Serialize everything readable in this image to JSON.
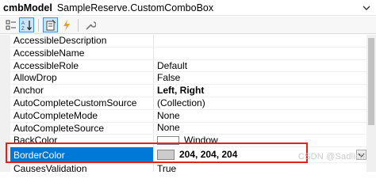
{
  "header": {
    "name": "cmbModel",
    "type": "SampleReserve.CustomComboBox"
  },
  "toolbar": {
    "buttons": [
      {
        "icon": "categorized-icon"
      },
      {
        "icon": "alphabetical-icon"
      },
      {
        "icon": "properties-icon"
      },
      {
        "icon": "events-lightning-icon"
      },
      {
        "icon": "property-pages-wrench-icon"
      }
    ]
  },
  "properties": [
    {
      "name": "AccessibleDescription",
      "value": ""
    },
    {
      "name": "AccessibleName",
      "value": ""
    },
    {
      "name": "AccessibleRole",
      "value": "Default"
    },
    {
      "name": "AllowDrop",
      "value": "False"
    },
    {
      "name": "Anchor",
      "value": "Left, Right"
    },
    {
      "name": "AutoCompleteCustomSource",
      "value": "(Collection)"
    },
    {
      "name": "AutoCompleteMode",
      "value": "None"
    },
    {
      "name": "AutoCompleteSource",
      "value": "None"
    },
    {
      "name": "BackColor",
      "value": "Window"
    },
    {
      "name": "BorderColor",
      "value": "204, 204, 204"
    },
    {
      "name": "CausesValidation",
      "value": "True"
    }
  ],
  "colors": {
    "backcolor_swatch": "#ffffff",
    "bordercolor_swatch": "#cccccc",
    "selection": "#0078d7",
    "highlight_box": "#e2231a"
  },
  "watermark": "CSDN @Sadlich"
}
